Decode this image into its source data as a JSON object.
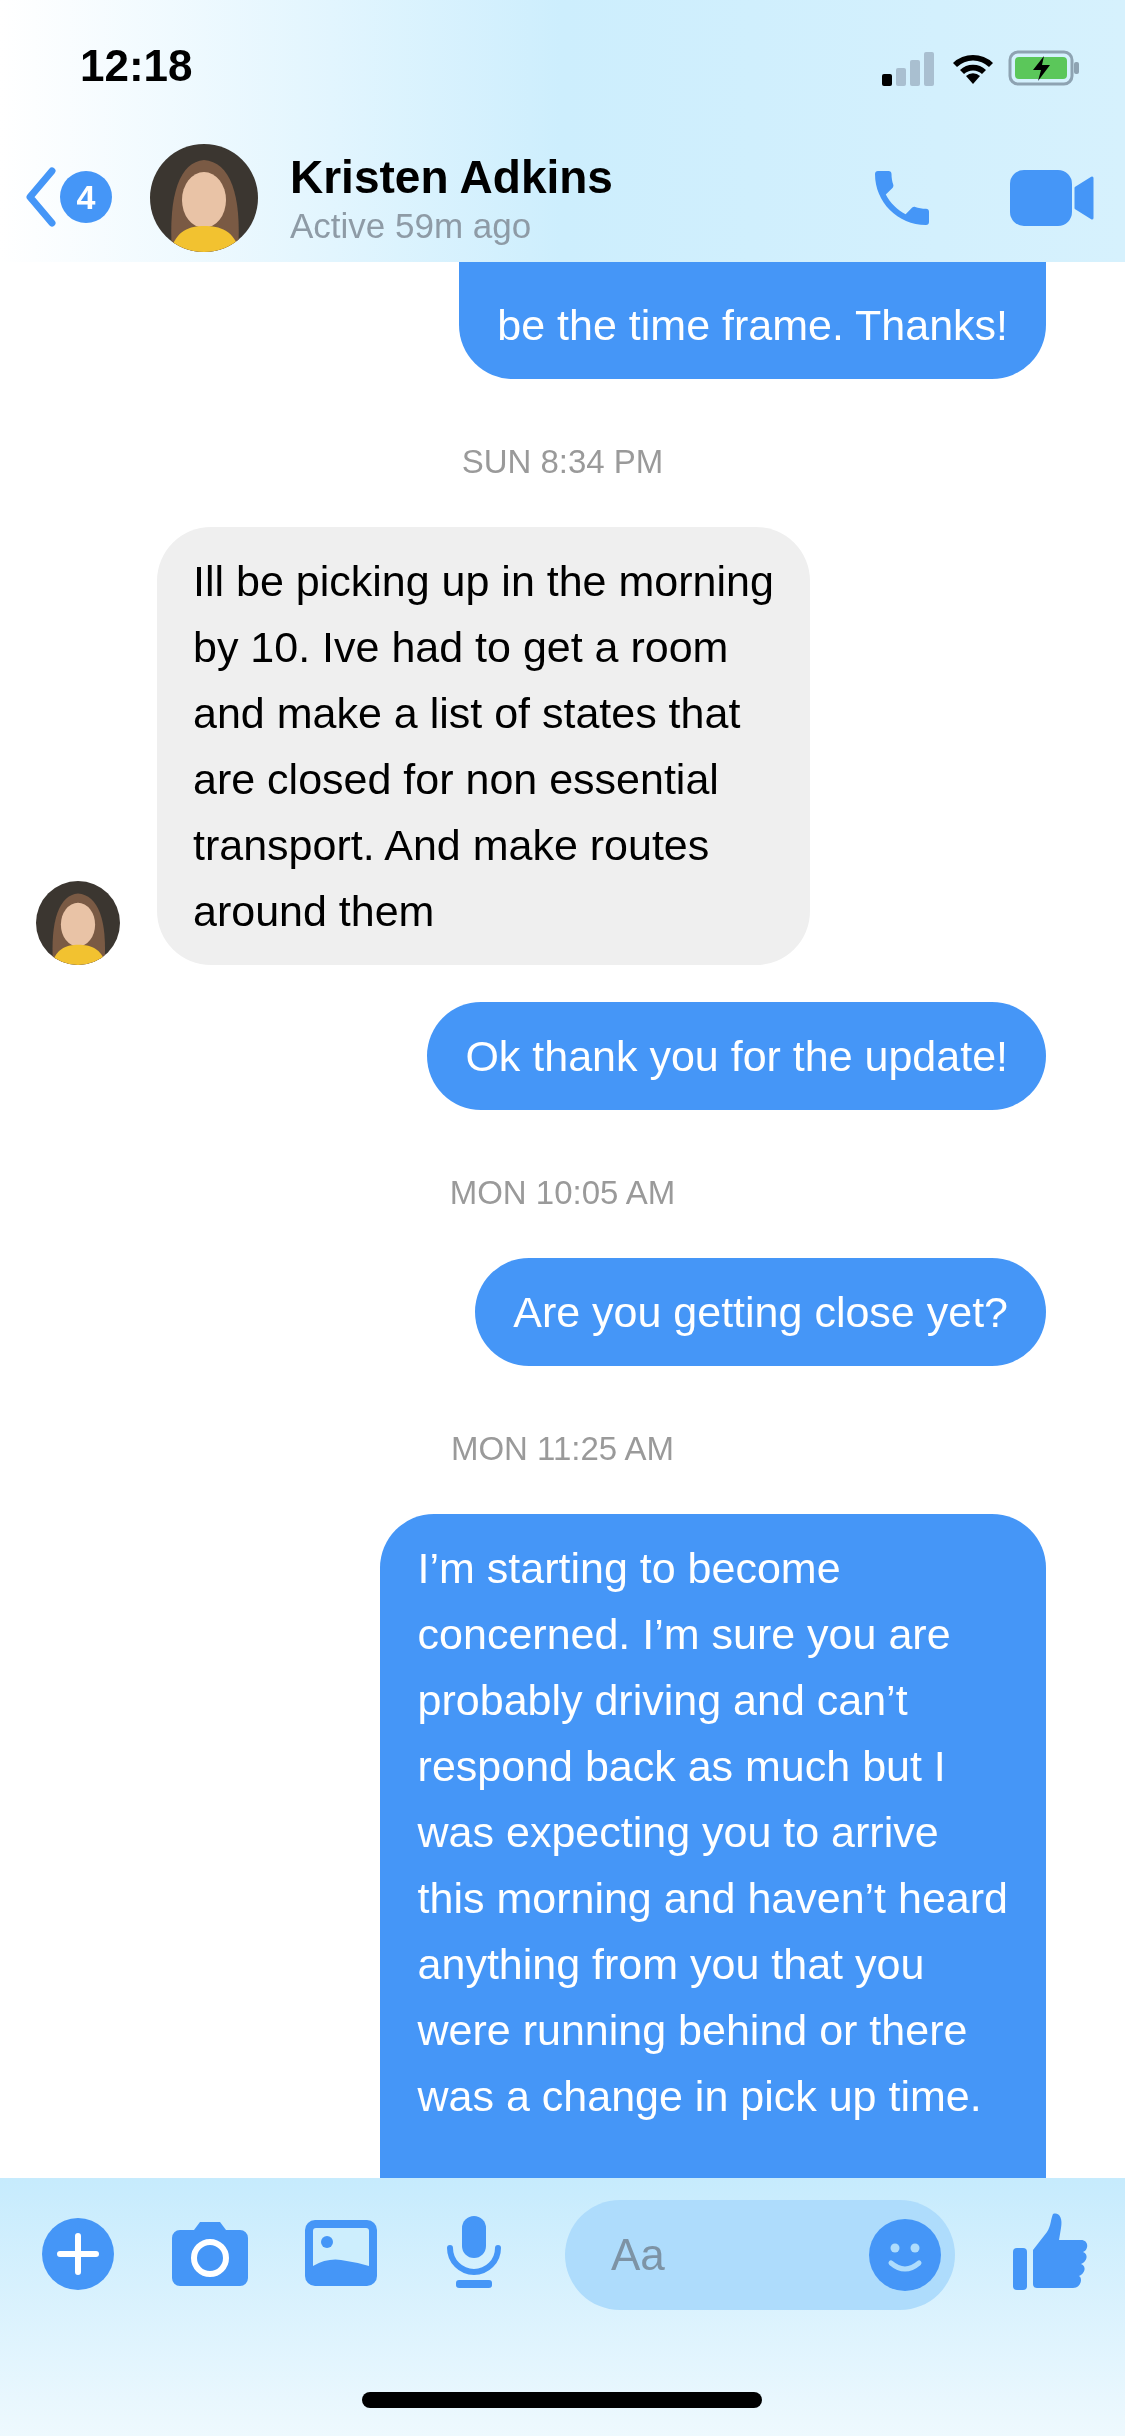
{
  "status_bar": {
    "time": "12:18"
  },
  "header": {
    "back_badge": "4",
    "contact_name": "Kristen Adkins",
    "status": "Active 59m ago"
  },
  "messages": [
    {
      "kind": "outgoing",
      "text": "be the time frame. Thanks!"
    },
    {
      "kind": "timestamp",
      "text": "SUN 8:34 PM"
    },
    {
      "kind": "incoming",
      "text": "Ill be picking up in the morning\nby 10. Ive had to get a room\nand make a list of states that\nare closed for non essential\ntransport. And make routes\naround them"
    },
    {
      "kind": "outgoing",
      "text": "Ok thank you for the update!"
    },
    {
      "kind": "timestamp",
      "text": "MON 10:05 AM"
    },
    {
      "kind": "outgoing",
      "text": "Are you getting close yet?"
    },
    {
      "kind": "timestamp",
      "text": "MON 11:25 AM"
    },
    {
      "kind": "outgoing",
      "text": "I’m starting to become\nconcerned. I’m sure you are\nprobably driving and can’t\nrespond back as much but I\nwas expecting you to arrive\nthis morning and haven’t heard\nanything from you that you\nwere running behind or there\nwas a change in pick up time."
    }
  ],
  "composer": {
    "placeholder": "Aa"
  }
}
